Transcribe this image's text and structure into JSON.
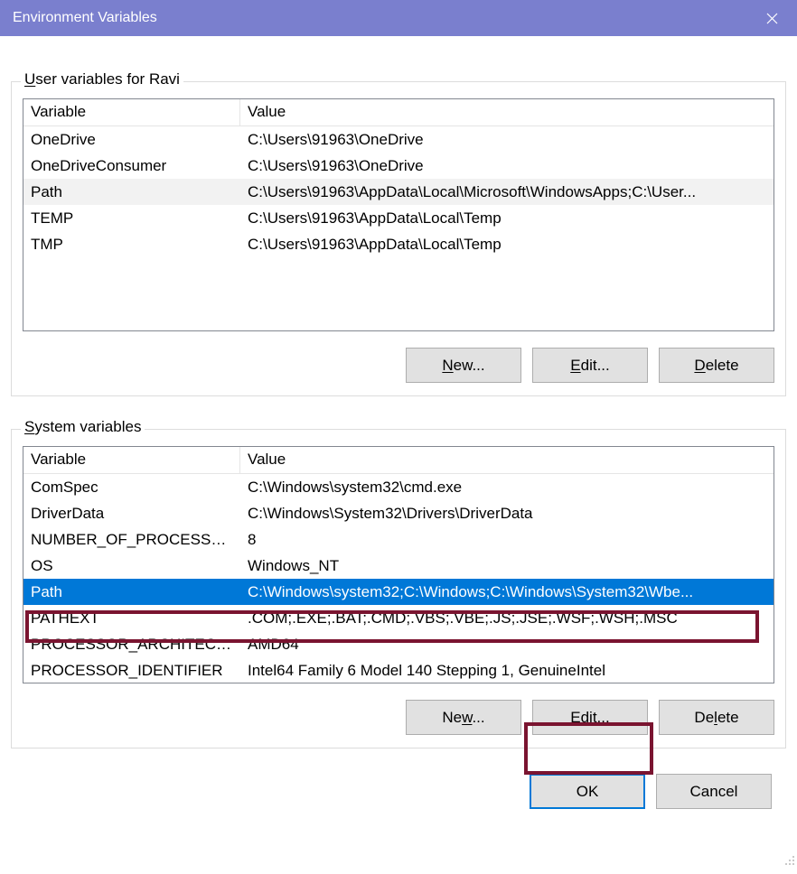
{
  "window": {
    "title": "Environment Variables"
  },
  "user_section": {
    "label_prefix": "U",
    "label_rest": "ser variables for Ravi",
    "columns": {
      "variable": "Variable",
      "value": "Value"
    },
    "rows": [
      {
        "variable": "OneDrive",
        "value": "C:\\Users\\91963\\OneDrive"
      },
      {
        "variable": "OneDriveConsumer",
        "value": "C:\\Users\\91963\\OneDrive"
      },
      {
        "variable": "Path",
        "value": "C:\\Users\\91963\\AppData\\Local\\Microsoft\\WindowsApps;C:\\User..."
      },
      {
        "variable": "TEMP",
        "value": "C:\\Users\\91963\\AppData\\Local\\Temp"
      },
      {
        "variable": "TMP",
        "value": "C:\\Users\\91963\\AppData\\Local\\Temp"
      }
    ],
    "hover_index": 2,
    "buttons": {
      "new_u": "N",
      "new_rest": "ew...",
      "edit_u": "E",
      "edit_rest": "dit...",
      "del_u": "D",
      "del_rest": "elete"
    }
  },
  "system_section": {
    "label_prefix": "S",
    "label_rest": "ystem variables",
    "columns": {
      "variable": "Variable",
      "value": "Value"
    },
    "rows": [
      {
        "variable": "ComSpec",
        "value": "C:\\Windows\\system32\\cmd.exe"
      },
      {
        "variable": "DriverData",
        "value": "C:\\Windows\\System32\\Drivers\\DriverData"
      },
      {
        "variable": "NUMBER_OF_PROCESSORS",
        "value": "8"
      },
      {
        "variable": "OS",
        "value": "Windows_NT"
      },
      {
        "variable": "Path",
        "value": "C:\\Windows\\system32;C:\\Windows;C:\\Windows\\System32\\Wbe..."
      },
      {
        "variable": "PATHEXT",
        "value": ".COM;.EXE;.BAT;.CMD;.VBS;.VBE;.JS;.JSE;.WSF;.WSH;.MSC"
      },
      {
        "variable": "PROCESSOR_ARCHITECTURE",
        "value": "AMD64"
      },
      {
        "variable": "PROCESSOR_IDENTIFIER",
        "value": "Intel64 Family 6 Model 140 Stepping 1, GenuineIntel"
      }
    ],
    "selected_index": 4,
    "buttons": {
      "new_u": "w",
      "new_pre": "Ne",
      "new_rest": "...",
      "edit_u": "i",
      "edit_pre": "Ed",
      "edit_rest": "t...",
      "del_u": "l",
      "del_pre": "De",
      "del_rest": "ete"
    }
  },
  "dialog_buttons": {
    "ok": "OK",
    "cancel": "Cancel"
  }
}
